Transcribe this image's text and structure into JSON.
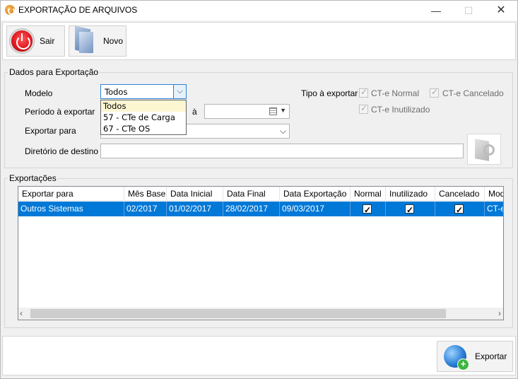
{
  "window": {
    "title": "EXPORTAÇÃO DE ARQUIVOS",
    "minimize_glyph": "—",
    "maximize_glyph": "☐",
    "close_glyph": "✕"
  },
  "toolbar": {
    "sair_label": "Sair",
    "novo_label": "Novo"
  },
  "dados": {
    "legend": "Dados para Exportação",
    "modelo_label": "Modelo",
    "modelo_value": "Todos",
    "modelo_options": [
      "Todos",
      "57 - CTe de Carga",
      "67 - CTe OS"
    ],
    "periodo_label": "Período à exportar",
    "periodo_separator": "à",
    "exportar_para_label": "Exportar para",
    "diretorio_label": "Diretório de destino",
    "tipo_label": "Tipo à exportar",
    "tipos": [
      {
        "label": "CT-e Normal",
        "checked": true
      },
      {
        "label": "CT-e Cancelado",
        "checked": true
      },
      {
        "label": "CT-e Inutilizado",
        "checked": true
      }
    ]
  },
  "exportacoes": {
    "legend": "Exportações",
    "columns": [
      "Exportar para",
      "Mês Base",
      "Data Inicial",
      "Data Final",
      "Data Exportação",
      "Normal",
      "Inutilizado",
      "Cancelado",
      "Mod"
    ],
    "rows": [
      {
        "exportar_para": "Outros Sistemas",
        "mes_base": "02/2017",
        "data_inicial": "01/02/2017",
        "data_final": "28/02/2017",
        "data_exportacao": "09/03/2017",
        "normal": true,
        "inutilizado": true,
        "cancelado": true,
        "mod": "CT-e"
      }
    ]
  },
  "footer": {
    "exportar_label": "Exportar"
  },
  "colors": {
    "selection": "#0078d7",
    "focus_border": "#2e7ed3",
    "dropdown_highlight": "#fdf6d2"
  }
}
